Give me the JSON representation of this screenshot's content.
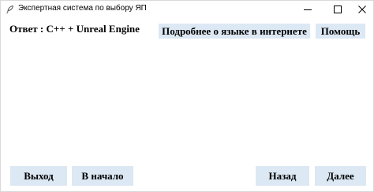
{
  "window": {
    "title": "Экспертная система по выбору ЯП"
  },
  "answer": {
    "label": "Ответ :",
    "value": "C++ + Unreal Engine"
  },
  "buttons": {
    "more_info": "Подробнее о языке в интернете",
    "help": "Помощь",
    "exit": "Выход",
    "to_start": "В начало",
    "back": "Назад",
    "next": "Далее"
  },
  "icons": {
    "app": "feather-icon",
    "minimize": "minimize-icon",
    "maximize": "maximize-icon",
    "close": "close-icon"
  },
  "colors": {
    "button_bg": "#dce8f3",
    "text": "#000000",
    "background": "#ffffff"
  }
}
